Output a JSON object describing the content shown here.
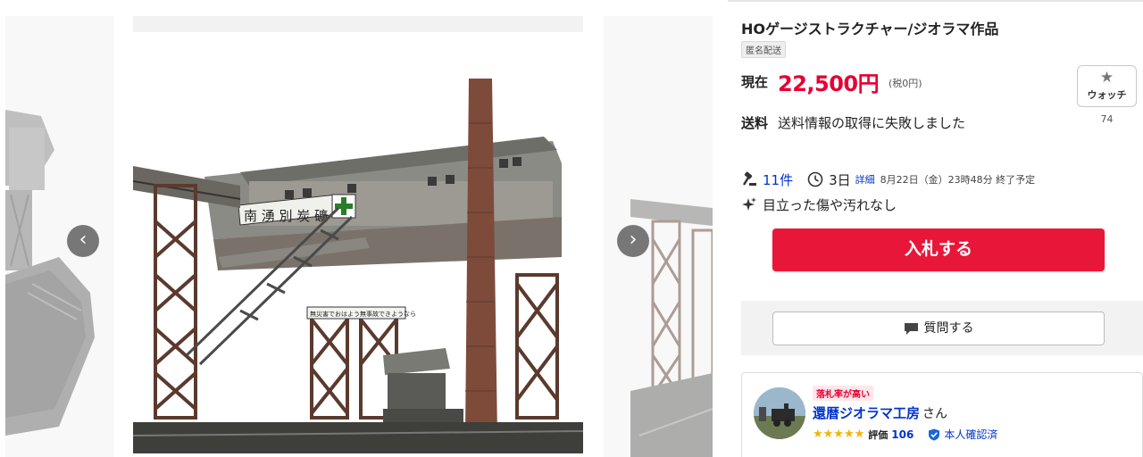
{
  "listing": {
    "title": "HOゲージストラクチャー/ジオラマ作品",
    "anonymous_badge": "匿名配送"
  },
  "price": {
    "label": "現在",
    "value": "22,500円",
    "tax_note": "(税0円)"
  },
  "watch": {
    "label": "ウォッチ",
    "count": "74"
  },
  "shipping": {
    "label": "送料",
    "text": "送料情報の取得に失敗しました"
  },
  "auction": {
    "bid_count": "11件",
    "time_left": "3日",
    "detail_link": "詳細",
    "end_date": "8月22日（金）23時48分 終了予定"
  },
  "condition": {
    "text": "目立った傷や汚れなし"
  },
  "actions": {
    "bid_button": "入札する",
    "question_button": "質問する"
  },
  "seller": {
    "badge": "落札率が高い",
    "name": "還暦ジオラマ工房",
    "honorific": "さん",
    "stars": "★★★★★",
    "rating_label": "評価",
    "rating_count": "106",
    "verified_label": "本人確認済"
  },
  "gallery": {
    "prev_icon": "‹",
    "next_icon": "›",
    "photo_sign_main": "南 湧 別 炭 礦",
    "photo_sign_sub": "無災害でおはよう無事故できようなら"
  },
  "icons": {
    "watch": "star-icon",
    "bids": "gavel-icon",
    "time": "clock-icon",
    "condition": "sparkle-icon",
    "question": "chat-bubble-icon",
    "verified": "shield-check-icon"
  },
  "colors": {
    "price": "#e60033",
    "bid_button": "#e8173a",
    "link": "#0033cc",
    "star": "#f3b400"
  }
}
